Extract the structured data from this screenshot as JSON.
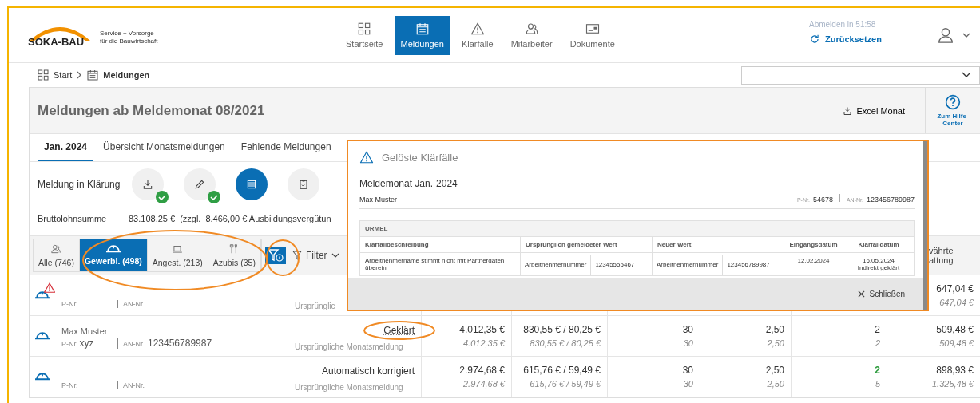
{
  "header": {
    "logo": {
      "name": "SOKA-BAU",
      "tagline": [
        "Service + Vorsorge",
        "für die Bauwirtschaft"
      ]
    },
    "nav": [
      {
        "label": "Startseite",
        "selected": false
      },
      {
        "label": "Meldungen",
        "selected": true
      },
      {
        "label": "Klärfälle",
        "selected": false
      },
      {
        "label": "Mitarbeiter",
        "selected": false
      },
      {
        "label": "Dokumente",
        "selected": false
      }
    ],
    "session": {
      "timer": "Abmelden in 51:58",
      "reset": "Zurücksetzen"
    }
  },
  "breadcrumb": [
    {
      "label": "Start"
    },
    {
      "label": "Meldungen"
    }
  ],
  "page": {
    "title": "Meldungen ab Meldemonat 08/2021",
    "excel": "Excel Monat",
    "help": "Zum Hilfe-Center"
  },
  "tabs": [
    {
      "label": "Jan. 2024",
      "selected": true
    },
    {
      "label": "Übersicht Monatsmeldungen",
      "selected": false
    },
    {
      "label": "Fehlende Meldungen",
      "selected": false
    }
  ],
  "status": {
    "label": "Meldung in Klärung",
    "steps": [
      {
        "done": true,
        "current": false
      },
      {
        "done": true,
        "current": false
      },
      {
        "done": false,
        "current": true
      },
      {
        "done": false,
        "current": false
      }
    ]
  },
  "totals": {
    "label": "Bruttolohnsumme",
    "value": "83.108,25 €",
    "extra": "(zzgl.",
    "extra_value": "8.466,00 € Ausbildungsvergütun"
  },
  "groups": [
    {
      "label": "Alle (746)",
      "selected": false
    },
    {
      "label": "Gewerbl. (498)",
      "selected": true
    },
    {
      "label": "Angest. (213)",
      "selected": false
    },
    {
      "label": "Azubis (35)",
      "selected": false
    }
  ],
  "filter": {
    "label": "Filter",
    "info_active": true
  },
  "last_column_header": [
    "vährte",
    "attung"
  ],
  "rows": [
    {
      "warning": true,
      "pnr_label": "P-Nr.",
      "an_label": "AN-Nr.",
      "original": "Ursprünglic",
      "total": {
        "value": "647,04 €",
        "original": "647,04 €"
      }
    },
    {
      "warning": false,
      "name": "Max Muster",
      "pnr_label": "P-Nr",
      "pnr": "xyz",
      "an_label": "AN-Nr.",
      "an": "123456789987",
      "status": "Geklärt",
      "status_link": true,
      "original": "Ursprüngliche Monatsmeldung",
      "cells": [
        {
          "value": "4.012,35 €",
          "original": "4.012,35 €",
          "changed": false
        },
        {
          "value": "830,55 € / 80,25 €",
          "original": "830,55 € / 80,25 €",
          "changed": false
        },
        {
          "value": "30",
          "original": "30",
          "changed": false
        },
        {
          "value": "2,50",
          "original": "2,50",
          "changed": false
        },
        {
          "value": "2",
          "original": "2",
          "changed": false
        }
      ],
      "total": {
        "value": "509,48 €",
        "original": "509,48 €"
      }
    },
    {
      "warning": false,
      "pnr_label": "P-Nr.",
      "an_label": "AN-Nr.",
      "status": "Automatisch korrigiert",
      "status_link": false,
      "original": "Ursprüngliche Monatsmeldung",
      "cells": [
        {
          "value": "2.974,68 €",
          "original": "2.974,68 €",
          "changed": false
        },
        {
          "value": "615,76 € / 59,49 €",
          "original": "615,76 € / 59,49 €",
          "changed": false
        },
        {
          "value": "30",
          "original": "30",
          "changed": false
        },
        {
          "value": "2,50",
          "original": "2,50",
          "changed": false
        },
        {
          "value": "2",
          "original": "5",
          "changed": true
        }
      ],
      "total": {
        "value": "898,93 €",
        "original": "1.325,48 €"
      }
    }
  ],
  "modal": {
    "title": "Gelöste Klärfälle",
    "month_label": "Meldemonat Jan.",
    "month_year": "2024",
    "person": "Max Muster",
    "pnr_label": "P-Nr.",
    "pnr": "54678",
    "an_label": "AN-Nr.",
    "an": "123456789987",
    "table": {
      "group": "URMEL",
      "columns": [
        "Klärfallbeschreibung",
        "Ursprünglich gemeldeter Wert",
        "Neuer Wert",
        "Eingangsdatum",
        "Klärfalldatum"
      ],
      "rows": [
        {
          "description": "Arbeitnehmername stimmt nicht mit Partnerdaten überein",
          "original_field": "Arbeitnehmernummer",
          "original_value": "12345555467",
          "new_field": "Arbeitnehmernummer",
          "new_value": "123456789987",
          "received": "12.02.2024",
          "resolved": "16.05.2024",
          "resolution": "Indirekt geklärt"
        }
      ]
    },
    "close": "Schließen"
  }
}
